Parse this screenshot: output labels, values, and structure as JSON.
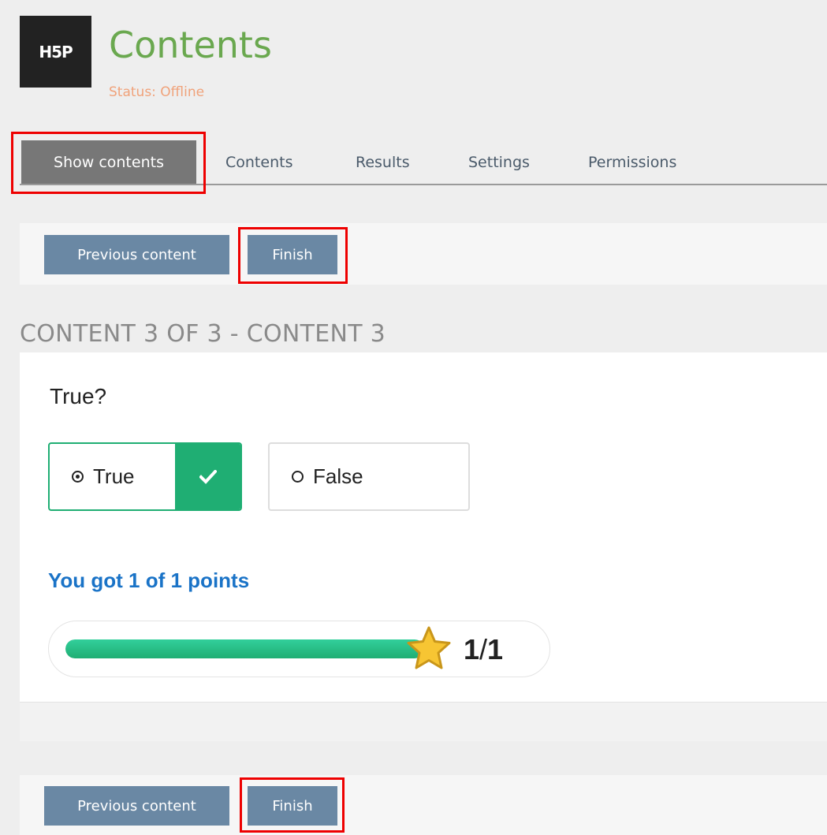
{
  "header": {
    "logo_text": "H5P",
    "title": "Contents",
    "status": "Status: Offline"
  },
  "tabs": [
    {
      "label": "Show contents",
      "active": true
    },
    {
      "label": "Contents"
    },
    {
      "label": "Results"
    },
    {
      "label": "Settings"
    },
    {
      "label": "Permissions"
    }
  ],
  "nav_top": {
    "previous_label": "Previous content",
    "finish_label": "Finish"
  },
  "section_title": "CONTENT 3 OF 3 - CONTENT 3",
  "question": {
    "text": "True?",
    "answers": [
      {
        "label": "True",
        "selected": true,
        "correct": true
      },
      {
        "label": "False",
        "selected": false
      }
    ]
  },
  "feedback": {
    "score_text": "You got 1 of 1 points",
    "score": 1,
    "max_score": 1,
    "score_display_left": "1",
    "score_display_sep": "/",
    "score_display_right": "1",
    "progress_fraction": 1.0
  },
  "nav_bottom": {
    "previous_label": "Previous content",
    "finish_label": "Finish"
  },
  "colors": {
    "accent_green": "#1fae73",
    "button_blue": "#6a88a4",
    "title_green": "#6aa84f",
    "status_orange": "#f0a27a",
    "highlight_red": "#ee0000",
    "score_blue": "#1a73c7"
  },
  "icons": [
    "h5p-logo",
    "radio-selected-icon",
    "radio-empty-icon",
    "check-icon",
    "star-icon"
  ]
}
